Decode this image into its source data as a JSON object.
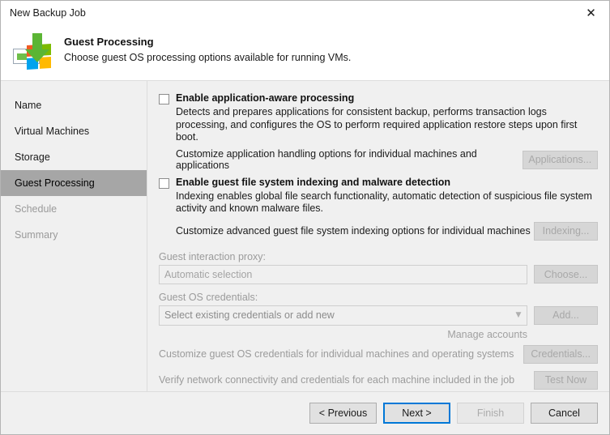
{
  "window": {
    "title": "New Backup Job",
    "close_icon": "close-icon"
  },
  "header": {
    "title": "Guest Processing",
    "subtitle": "Choose guest OS processing options available for running VMs.",
    "icon": "guest-processing-icon"
  },
  "sidebar": {
    "items": [
      {
        "label": "Name",
        "state": "enabled"
      },
      {
        "label": "Virtual Machines",
        "state": "enabled"
      },
      {
        "label": "Storage",
        "state": "enabled"
      },
      {
        "label": "Guest Processing",
        "state": "selected"
      },
      {
        "label": "Schedule",
        "state": "disabled"
      },
      {
        "label": "Summary",
        "state": "disabled"
      }
    ]
  },
  "main": {
    "app_aware": {
      "checkbox_label": "Enable application-aware processing",
      "checked": false,
      "description": "Detects and prepares applications for consistent backup, performs transaction logs processing, and configures the OS to perform required application restore steps upon first boot.",
      "customize_text": "Customize application handling options for individual machines and applications",
      "button_label": "Applications...",
      "button_enabled": false
    },
    "indexing": {
      "checkbox_label": "Enable guest file system indexing and malware detection",
      "checked": false,
      "description": "Indexing enables global file search functionality, automatic detection of suspicious file system activity and known malware files.",
      "customize_text": "Customize advanced guest file system indexing options for individual machines",
      "button_label": "Indexing...",
      "button_enabled": false
    },
    "proxy": {
      "label": "Guest interaction proxy:",
      "value": "Automatic selection",
      "button_label": "Choose...",
      "button_enabled": false
    },
    "credentials": {
      "label": "Guest OS credentials:",
      "value": "Select existing credentials or add new",
      "dropdown_icon": "chevron-down-icon",
      "button_label": "Add...",
      "button_enabled": false,
      "manage_link": "Manage accounts"
    },
    "customize_credentials": {
      "text": "Customize guest OS credentials for individual machines and operating systems",
      "button_label": "Credentials...",
      "button_enabled": false
    },
    "verify": {
      "text": "Verify network connectivity and credentials for each machine included in the job",
      "button_label": "Test Now",
      "button_enabled": false
    }
  },
  "footer": {
    "previous_label": "< Previous",
    "next_label": "Next >",
    "finish_label": "Finish",
    "cancel_label": "Cancel",
    "finish_enabled": false,
    "focus_color": "#0078d7"
  }
}
